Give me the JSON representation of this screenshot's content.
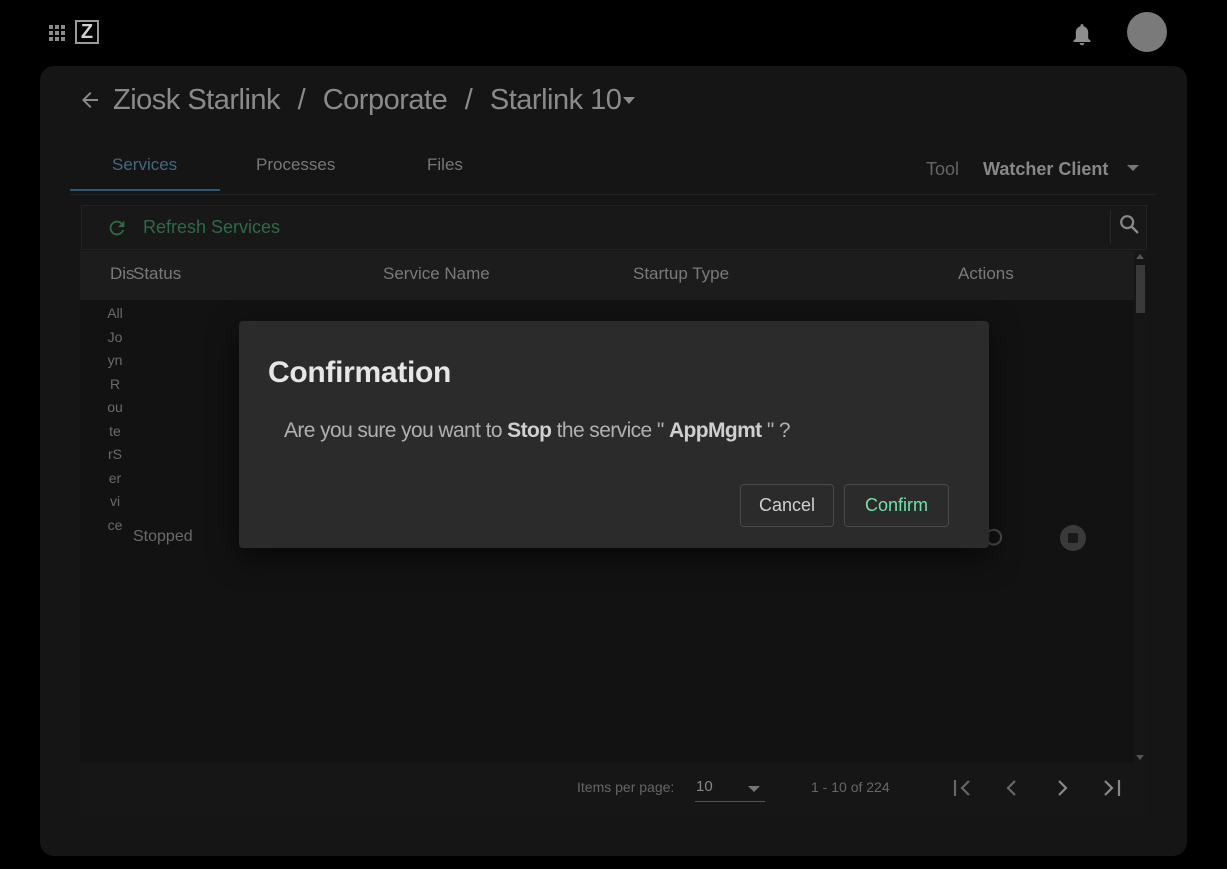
{
  "topbar": {
    "apps_icon": "apps-grid-icon",
    "logo_letter": "Z",
    "notifications_icon": "bell-icon",
    "avatar": "user-avatar"
  },
  "breadcrumb": {
    "items": [
      "Ziosk Starlink",
      "Corporate",
      "Starlink 10"
    ],
    "separator": "/"
  },
  "tabs": [
    "Services",
    "Processes",
    "Files"
  ],
  "active_tab": "Services",
  "tool": {
    "label": "Tool",
    "value": "Watcher Client"
  },
  "services": {
    "refresh_label": "Refresh Services",
    "columns": [
      "Dis",
      "Status",
      "Service Name",
      "Startup Type",
      "Actions"
    ],
    "row": {
      "display_name": "AllJoynRouterService",
      "status": "Stopped"
    }
  },
  "paginator": {
    "items_per_page_label": "Items per page:",
    "items_per_page": "10",
    "range": "1 - 10 of 224"
  },
  "dialog": {
    "title": "Confirmation",
    "msg_prefix": "Are you sure you want to",
    "action": "Stop",
    "msg_middle": "the service \"",
    "service": "AppMgmt",
    "msg_suffix": "\" ?",
    "cancel_label": "Cancel",
    "confirm_label": "Confirm"
  },
  "colors": {
    "accent_green": "#6ee3a8",
    "dialog_bg": "#2b2b2b",
    "tab_active": "#3f6b80"
  }
}
